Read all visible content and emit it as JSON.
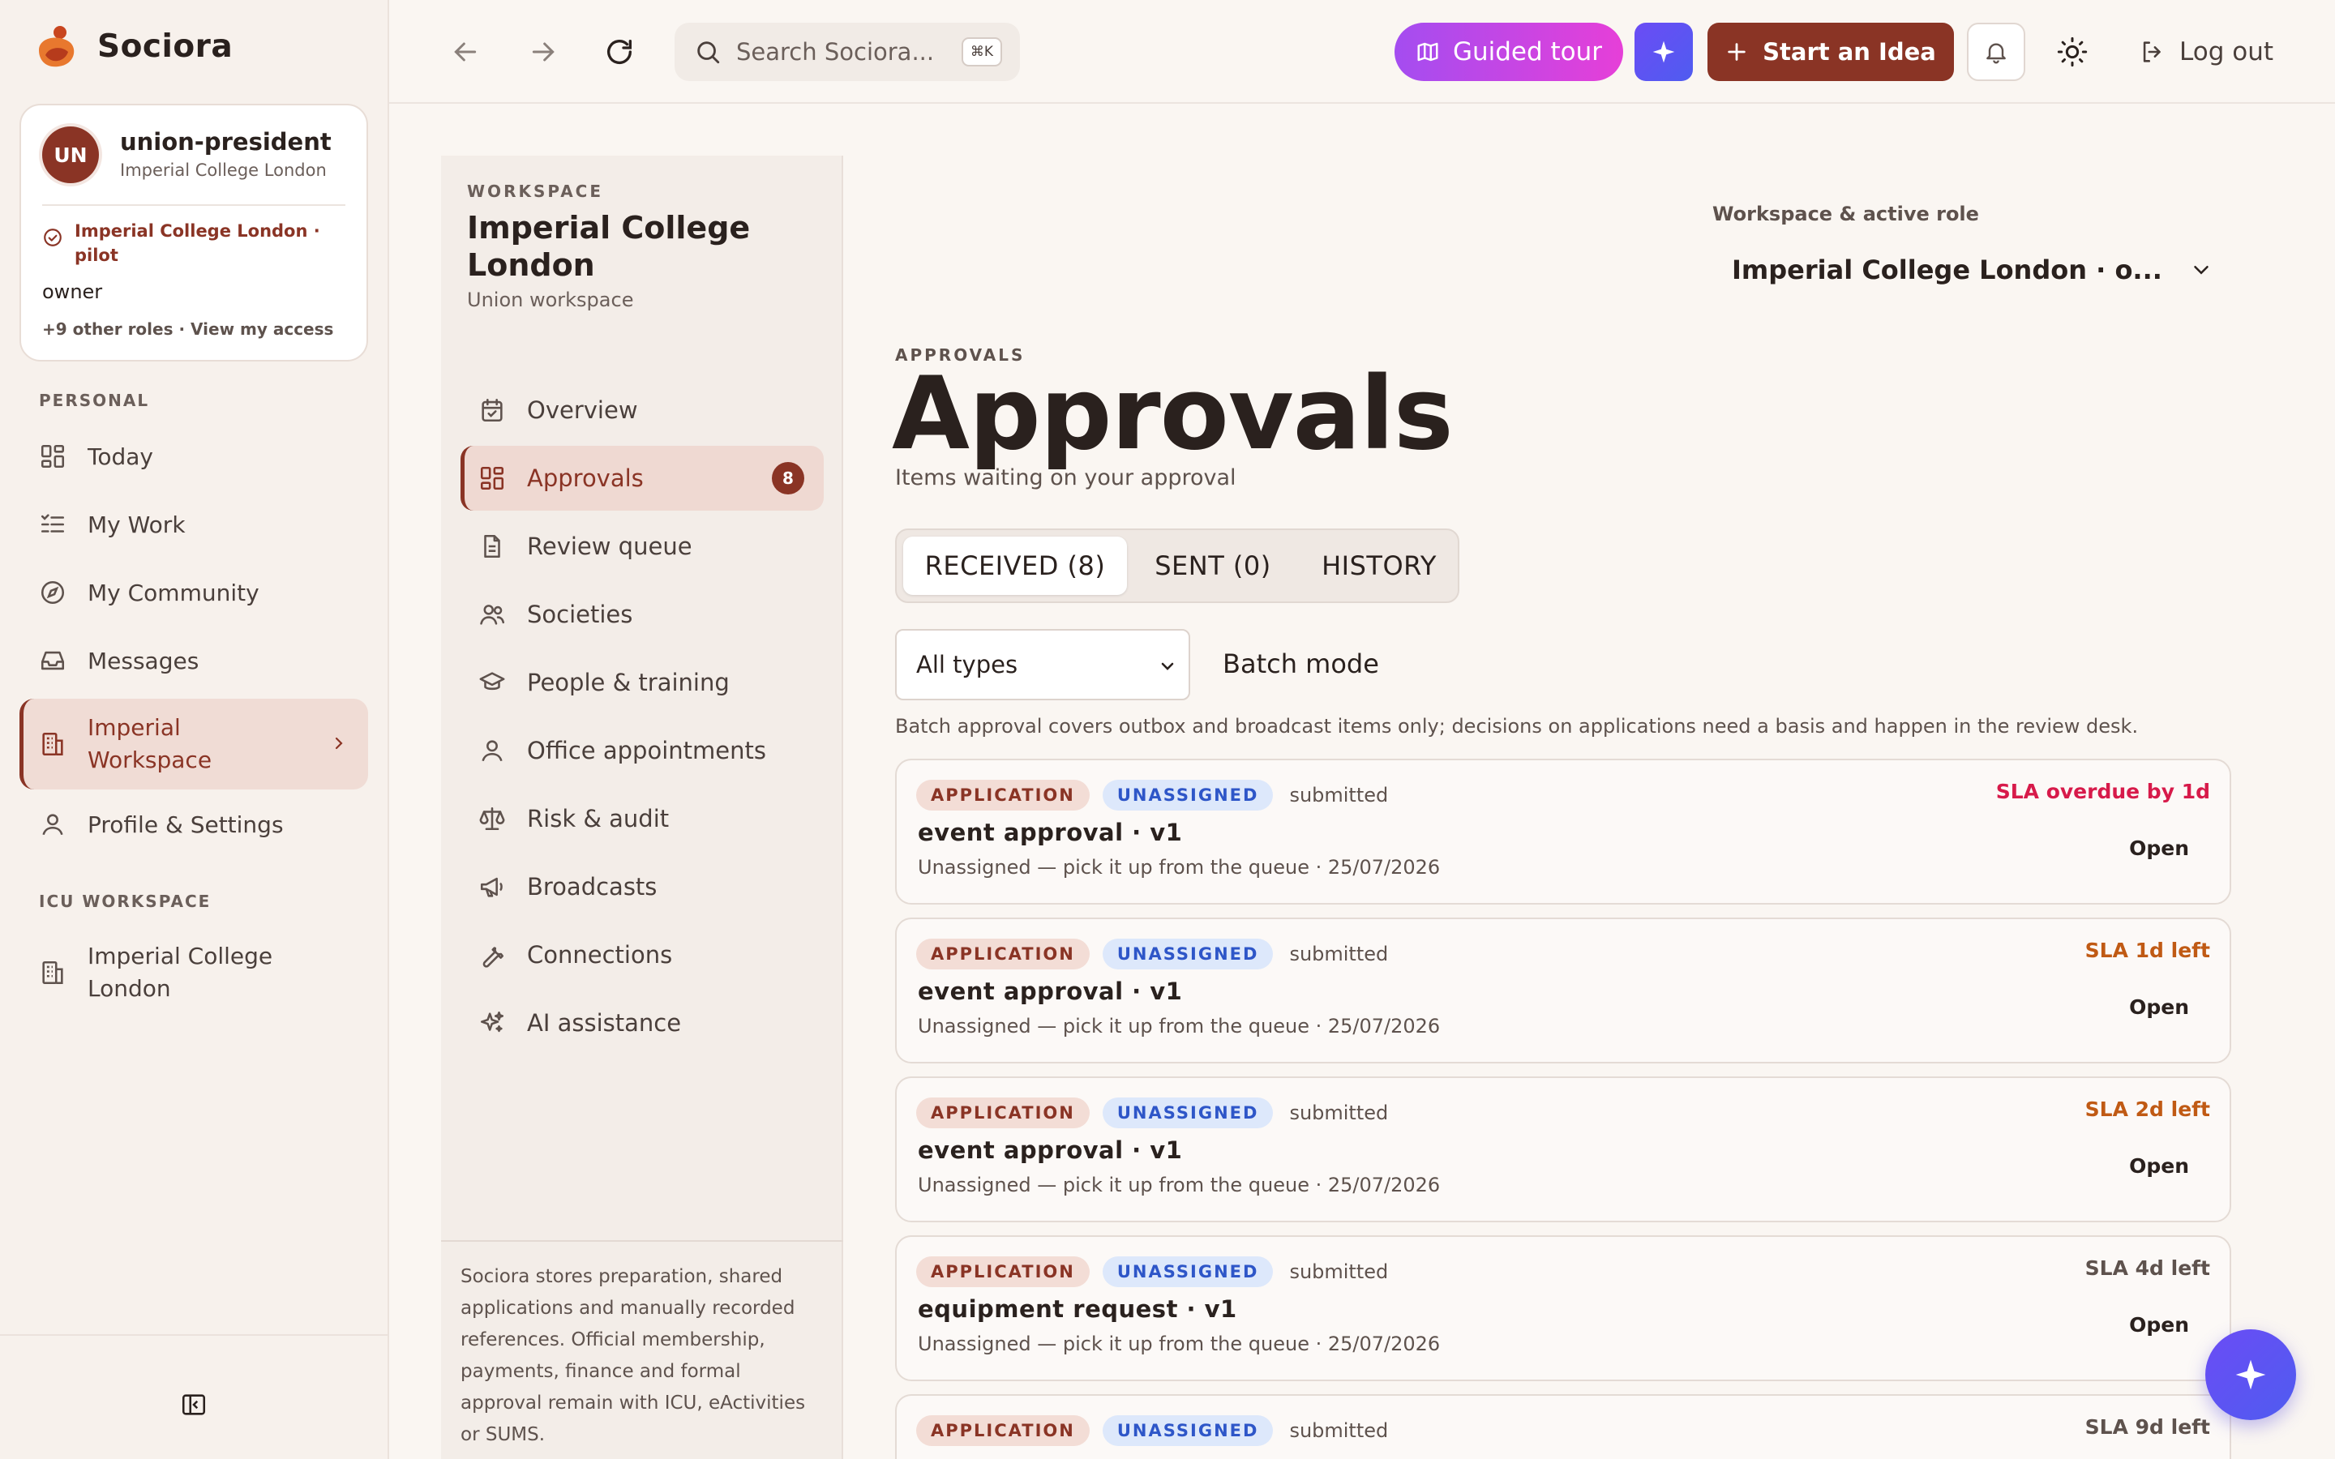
{
  "app": {
    "name": "Sociora"
  },
  "user": {
    "initials": "UN",
    "name": "union-president",
    "org": "Imperial College London",
    "pilot": "Imperial College London · pilot",
    "role": "owner",
    "roles_link": "+9 other roles · View my access"
  },
  "sidebar": {
    "personal_label": "PERSONAL",
    "items": [
      {
        "label": "Today",
        "icon": "dashboard-icon"
      },
      {
        "label": "My Work",
        "icon": "checklist-icon"
      },
      {
        "label": "My Community",
        "icon": "compass-icon"
      },
      {
        "label": "Messages",
        "icon": "inbox-icon"
      },
      {
        "label": "Imperial Workspace",
        "icon": "building-icon",
        "active": true
      },
      {
        "label": "Profile & Settings",
        "icon": "user-icon"
      }
    ],
    "icu_label": "ICU WORKSPACE",
    "icu_items": [
      {
        "label": "Imperial College London",
        "icon": "building-icon"
      }
    ]
  },
  "topbar": {
    "search_placeholder": "Search Sociora...",
    "search_shortcut": "⌘K",
    "guided_tour": "Guided tour",
    "start_idea": "Start an Idea",
    "logout": "Log out"
  },
  "workspace": {
    "kicker": "WORKSPACE",
    "title": "Imperial College London",
    "subtitle": "Union workspace",
    "items": [
      {
        "label": "Overview",
        "icon": "calendar-icon"
      },
      {
        "label": "Approvals",
        "icon": "grid-icon",
        "active": true,
        "badge": "8"
      },
      {
        "label": "Review queue",
        "icon": "document-icon"
      },
      {
        "label": "Societies",
        "icon": "users-icon"
      },
      {
        "label": "People & training",
        "icon": "graduation-cap-icon"
      },
      {
        "label": "Office appointments",
        "icon": "person-icon"
      },
      {
        "label": "Risk & audit",
        "icon": "scales-icon"
      },
      {
        "label": "Broadcasts",
        "icon": "megaphone-icon"
      },
      {
        "label": "Connections",
        "icon": "wrench-icon"
      },
      {
        "label": "AI assistance",
        "icon": "sparkles-icon"
      }
    ],
    "footer": "Sociora stores preparation, shared applications and manually recorded references. Official membership, payments, finance and formal approval remain with ICU, eActivities or SUMS."
  },
  "role_picker": {
    "label": "Workspace & active role",
    "value": "Imperial College London · o..."
  },
  "page": {
    "kicker": "APPROVALS",
    "title": "Approvals",
    "subtitle": "Items waiting on your approval",
    "tabs": [
      {
        "label": "RECEIVED (8)",
        "active": true
      },
      {
        "label": "SENT (0)"
      },
      {
        "label": "HISTORY"
      }
    ],
    "filter_value": "All types",
    "batch_mode": "Batch mode",
    "batch_note": "Batch approval covers outbox and broadcast items only; decisions on applications need a basis and happen in the review desk."
  },
  "approvals": [
    {
      "type": "APPLICATION",
      "assignee": "UNASSIGNED",
      "status": "submitted",
      "title": "event approval · v1",
      "meta": "Unassigned — pick it up from the queue · 25/07/2026",
      "sla": "SLA overdue by 1d",
      "sla_level": "overdue",
      "action": "Open"
    },
    {
      "type": "APPLICATION",
      "assignee": "UNASSIGNED",
      "status": "submitted",
      "title": "event approval · v1",
      "meta": "Unassigned — pick it up from the queue · 25/07/2026",
      "sla": "SLA 1d left",
      "sla_level": "soon",
      "action": "Open"
    },
    {
      "type": "APPLICATION",
      "assignee": "UNASSIGNED",
      "status": "submitted",
      "title": "event approval · v1",
      "meta": "Unassigned — pick it up from the queue · 25/07/2026",
      "sla": "SLA 2d left",
      "sla_level": "soon",
      "action": "Open"
    },
    {
      "type": "APPLICATION",
      "assignee": "UNASSIGNED",
      "status": "submitted",
      "title": "equipment request · v1",
      "meta": "Unassigned — pick it up from the queue · 25/07/2026",
      "sla": "SLA 4d left",
      "sla_level": "ok",
      "action": "Open"
    },
    {
      "type": "APPLICATION",
      "assignee": "UNASSIGNED",
      "status": "submitted",
      "title": "",
      "meta": "",
      "sla": "SLA 9d left",
      "sla_level": "ok",
      "action": ""
    }
  ],
  "colors": {
    "brand": "#8a3425",
    "sla_overdue": "#d71a4a",
    "sla_soon": "#c05a14",
    "tag_unassigned": "#2e56c8"
  }
}
